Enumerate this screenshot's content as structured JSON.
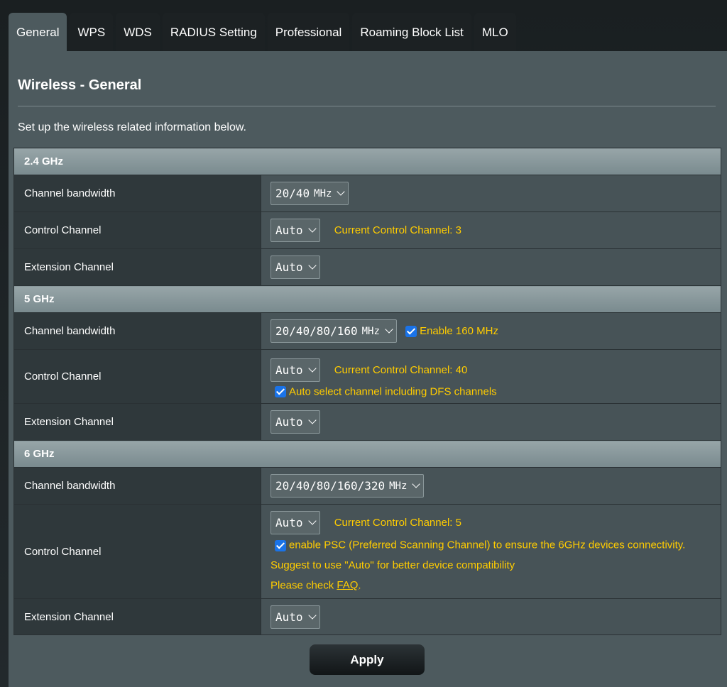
{
  "tabs": [
    {
      "label": "General"
    },
    {
      "label": "WPS"
    },
    {
      "label": "WDS"
    },
    {
      "label": "RADIUS Setting"
    },
    {
      "label": "Professional"
    },
    {
      "label": "Roaming Block List"
    },
    {
      "label": "MLO"
    }
  ],
  "page": {
    "title": "Wireless - General",
    "description": "Set up the wireless related information below."
  },
  "band24": {
    "header": "2.4 GHz",
    "bandwidth_label": "Channel bandwidth",
    "bandwidth_value": "20/40",
    "bandwidth_unit": "MHz",
    "control_label": "Control Channel",
    "control_value": "Auto",
    "current_channel": "Current Control Channel: 3",
    "extension_label": "Extension Channel",
    "extension_value": "Auto"
  },
  "band5": {
    "header": "5 GHz",
    "bandwidth_label": "Channel bandwidth",
    "bandwidth_value": "20/40/80/160",
    "bandwidth_unit": "MHz",
    "enable160_label": "Enable 160 MHz",
    "control_label": "Control Channel",
    "control_value": "Auto",
    "current_channel": "Current Control Channel: 40",
    "dfs_label": "Auto select channel including DFS channels",
    "extension_label": "Extension Channel",
    "extension_value": "Auto"
  },
  "band6": {
    "header": "6 GHz",
    "bandwidth_label": "Channel bandwidth",
    "bandwidth_value": "20/40/80/160/320",
    "bandwidth_unit": "MHz",
    "control_label": "Control Channel",
    "control_value": "Auto",
    "current_channel": "Current Control Channel: 5",
    "psc_label": "enable PSC (Preferred Scanning Channel) to ensure the 6GHz devices connectivity.",
    "suggest_text": "Suggest to use \"Auto\" for better device compatibility",
    "check_prefix": "Please check ",
    "faq_link": "FAQ",
    "check_suffix": ".",
    "extension_label": "Extension Channel",
    "extension_value": "Auto"
  },
  "apply_label": "Apply",
  "colors": {
    "accent_yellow": "#ffcc00",
    "checkbox_blue": "#1a73e8",
    "panel_bg": "#4d5a5e"
  }
}
